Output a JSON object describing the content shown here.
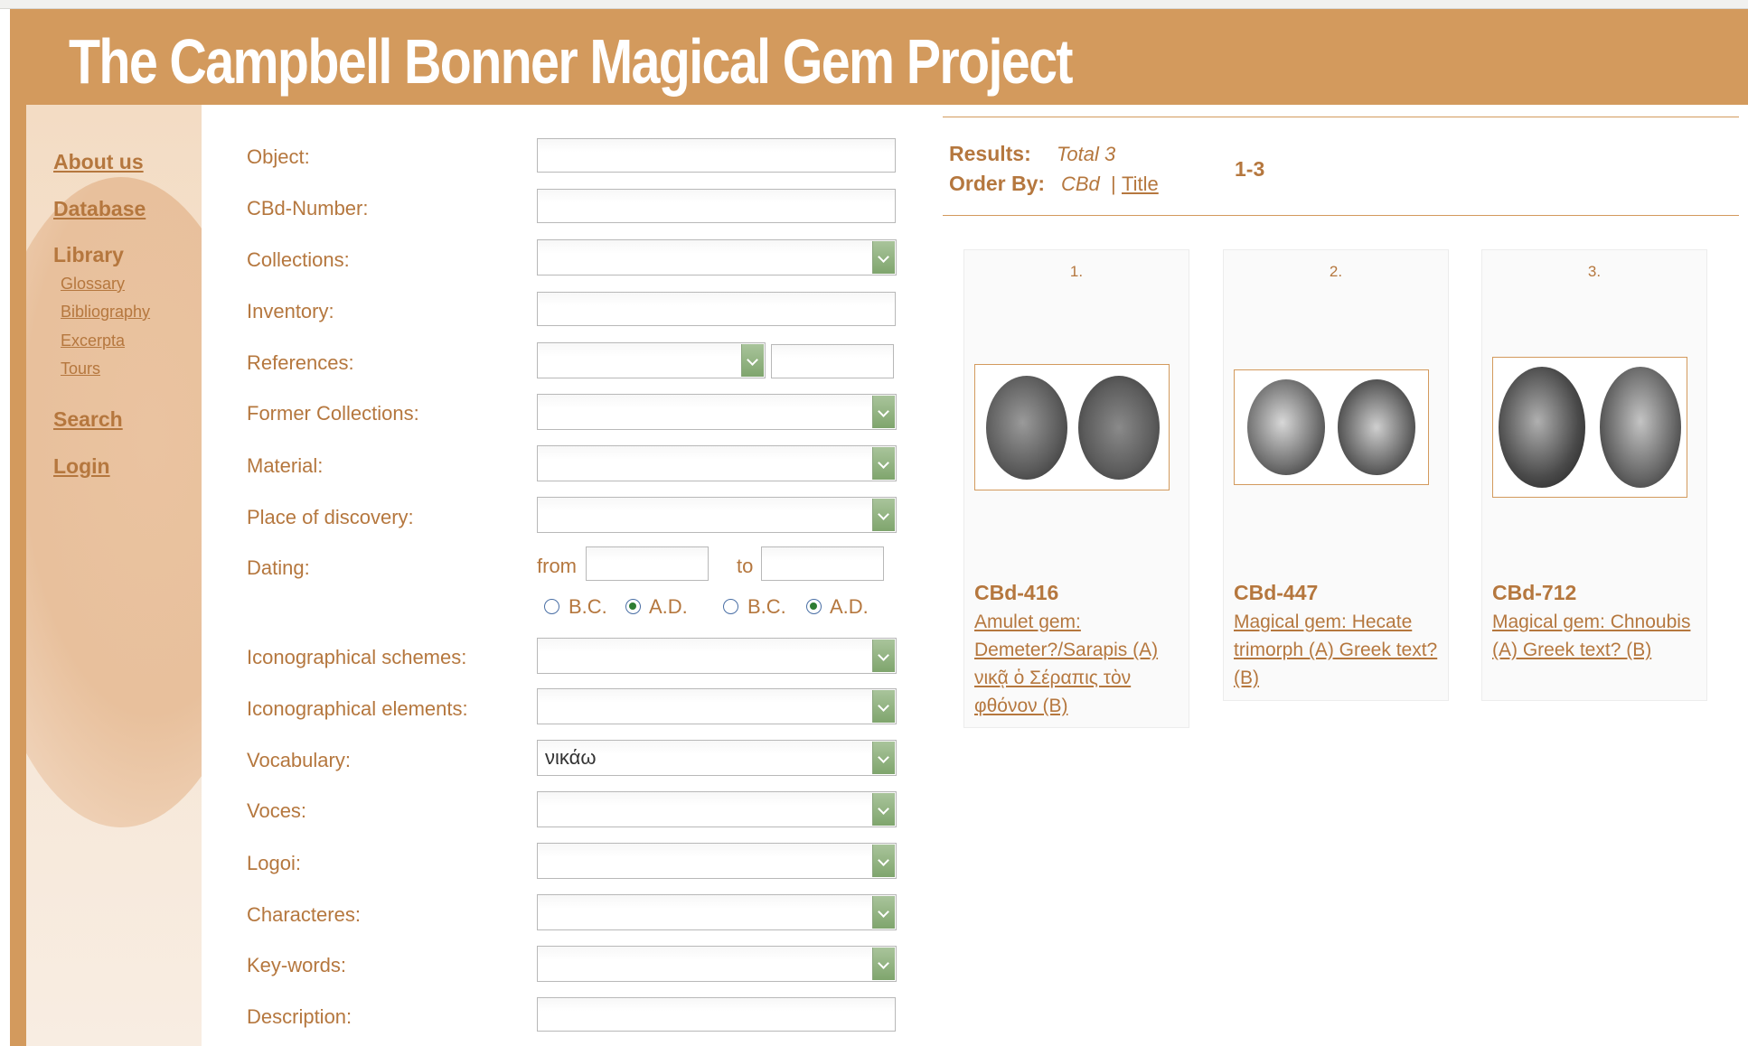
{
  "banner": {
    "title": "The Campbell Bonner Magical Gem Project"
  },
  "nav": {
    "about": "About us",
    "database": "Database",
    "library": "Library",
    "library_items": [
      "Glossary",
      "Bibliography",
      "Excerpta",
      "Tours"
    ],
    "search": "Search",
    "login": "Login"
  },
  "form": {
    "object": "Object:",
    "cbd_number": "CBd-Number:",
    "collections": "Collections:",
    "inventory": "Inventory:",
    "references": "References:",
    "former_collections": "Former Collections:",
    "material": "Material:",
    "place": "Place of discovery:",
    "dating": "Dating:",
    "dating_from": "from",
    "dating_to": "to",
    "bc": "B.C.",
    "ad": "A.D.",
    "icon_schemes": "Iconographical schemes:",
    "icon_elements": "Iconographical elements:",
    "vocabulary": "Vocabulary:",
    "vocabulary_value": "νικάω",
    "voces": "Voces:",
    "logoi": "Logoi:",
    "characteres": "Characteres:",
    "keywords": "Key-words:",
    "description": "Description:"
  },
  "results": {
    "results_label": "Results:",
    "total": "Total 3",
    "order_label": "Order By:",
    "order_cbd": "CBd",
    "order_sep": "|",
    "order_title": "Title",
    "range": "1-3",
    "items": [
      {
        "num": "1.",
        "id": "CBd-416",
        "title": "Amulet gem: Demeter?/Sarapis (A) νικᾷ ὁ Σέραπις τὸν φθόνον (B)"
      },
      {
        "num": "2.",
        "id": "CBd-447",
        "title": "Magical gem: Hecate trimorph (A) Greek text? (B)"
      },
      {
        "num": "3.",
        "id": "CBd-712",
        "title": "Magical gem: Chnoubis (A) Greek text? (B)"
      }
    ]
  },
  "colors": {
    "brand": "#d39a5d",
    "text": "#b5773e",
    "select_button": "#8fb07e"
  }
}
